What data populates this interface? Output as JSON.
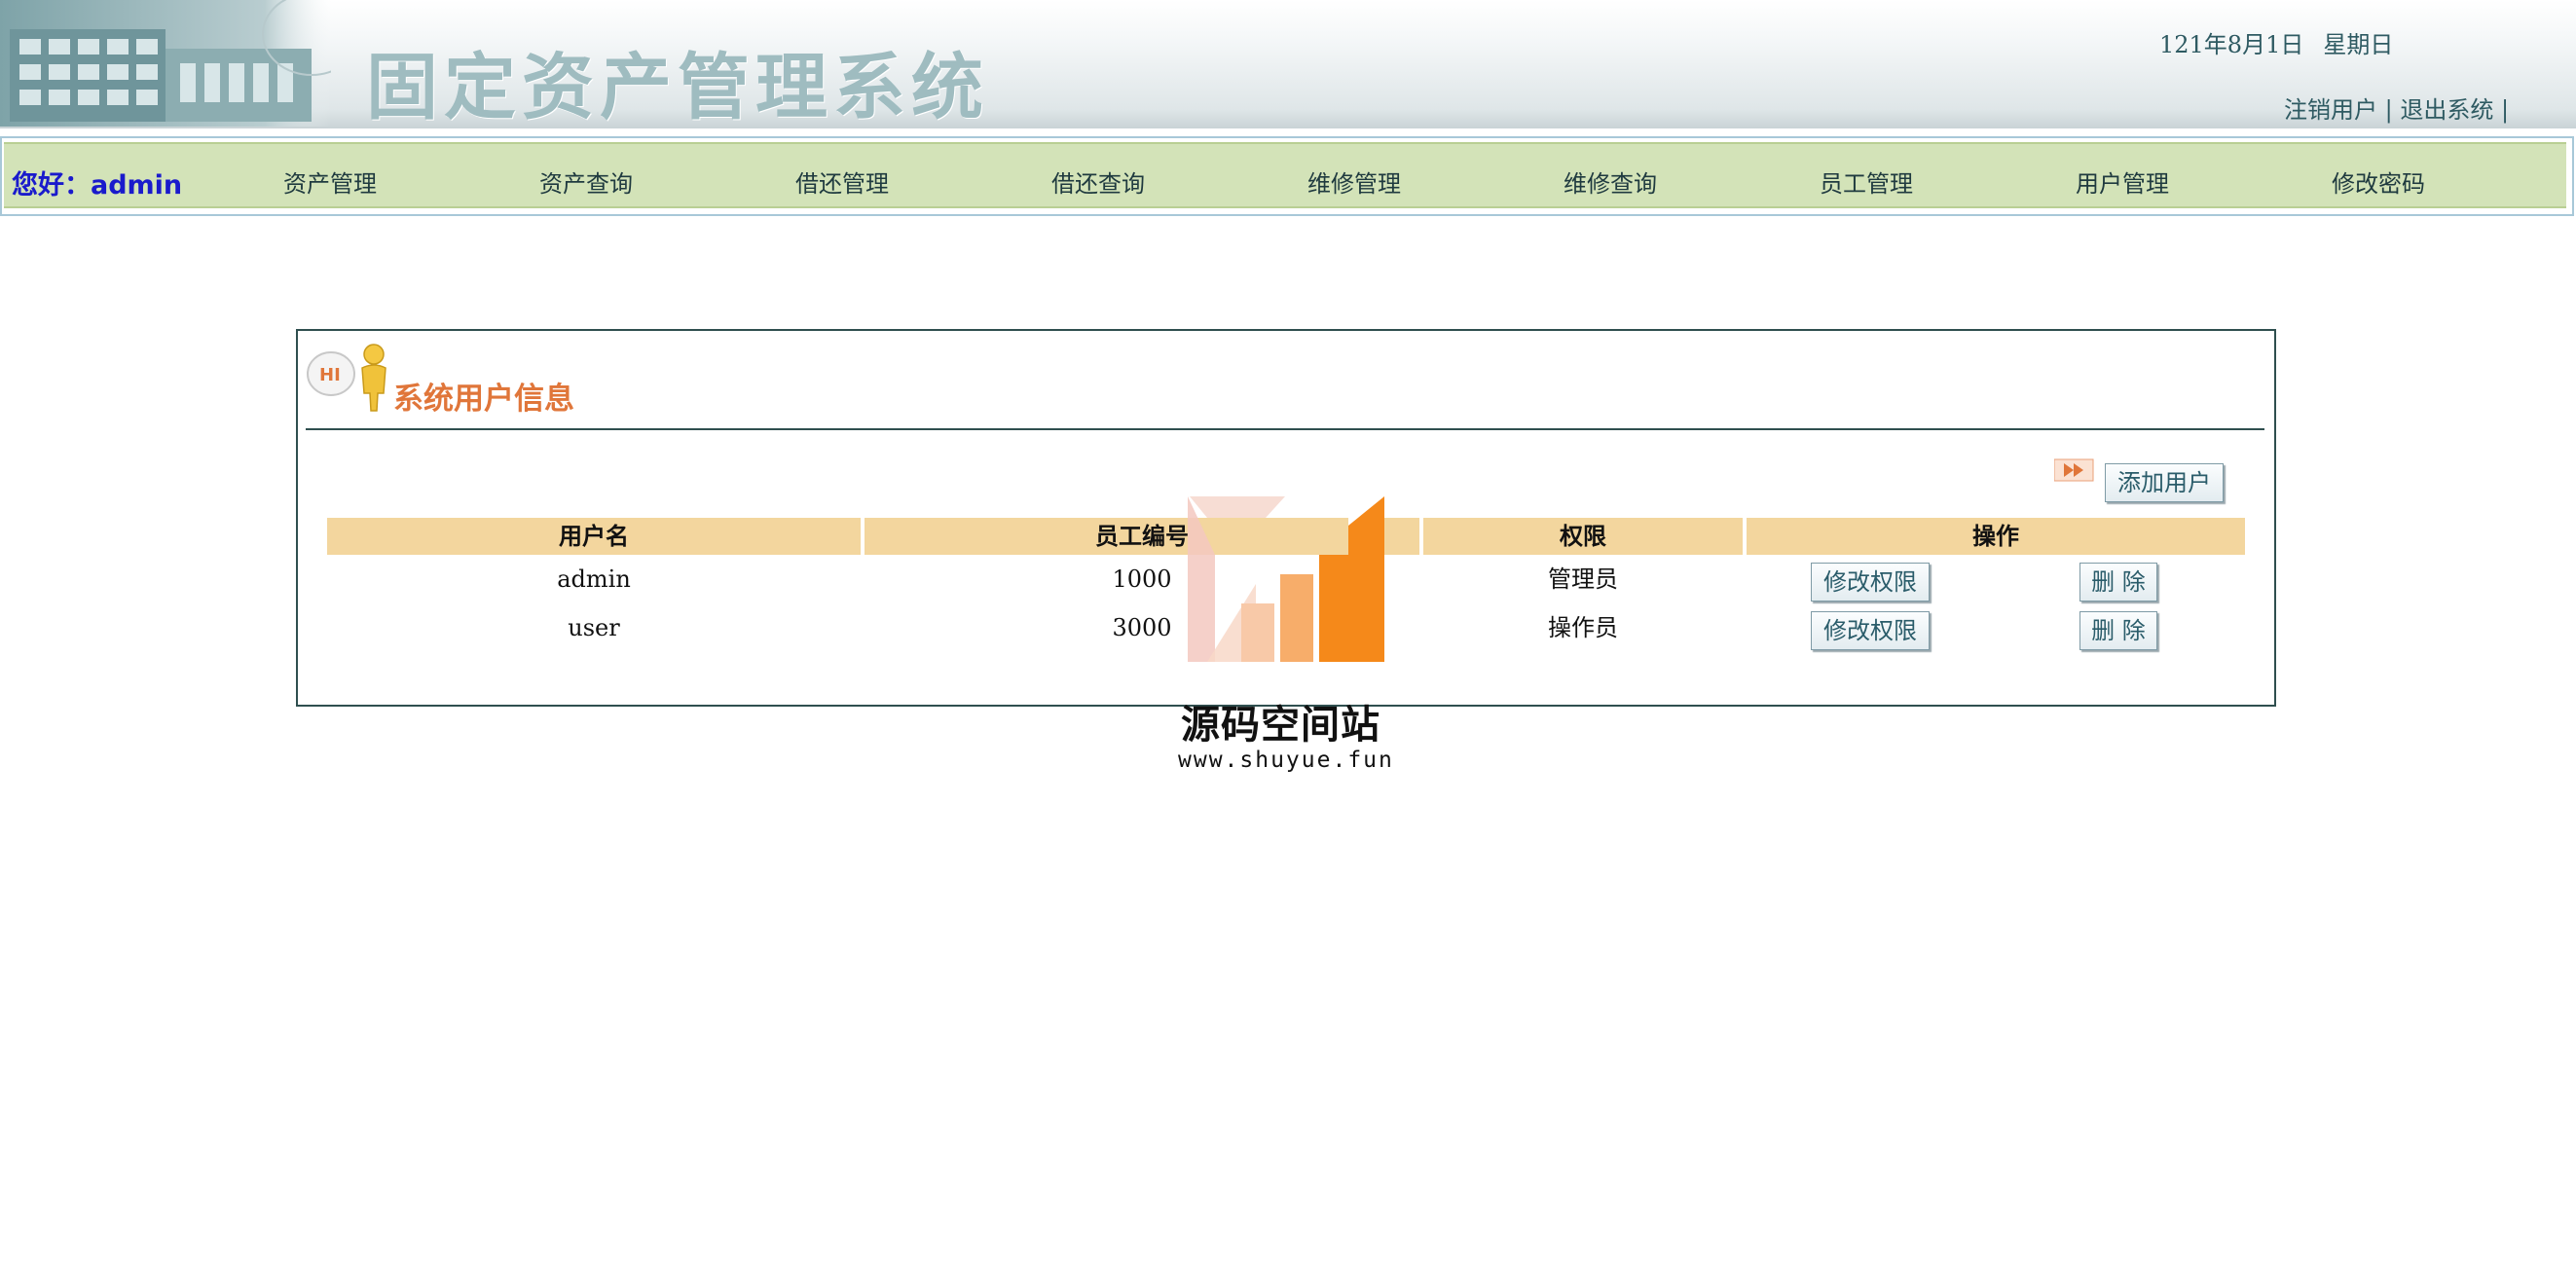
{
  "header": {
    "title": "固定资产管理系统",
    "date": "121年8月1日",
    "weekday": "星期日",
    "logout_user": "注销用户",
    "exit_system": "退出系统",
    "separator": "|"
  },
  "nav": {
    "greeting": "您好：admin",
    "items": [
      "资产管理",
      "资产查询",
      "借还管理",
      "借还查询",
      "维修管理",
      "维修查询",
      "员工管理",
      "用户管理",
      "修改密码"
    ]
  },
  "panel": {
    "title": "系统用户信息",
    "hi_badge": "HI",
    "add_user_button": "添加用户",
    "table": {
      "headers": [
        "用户名",
        "员工编号",
        "权限",
        "操作"
      ],
      "rows": [
        {
          "username": "admin",
          "employee_no": "1000",
          "role": "管理员",
          "edit_label": "修改权限",
          "delete_label": "删 除"
        },
        {
          "username": "user",
          "employee_no": "3000",
          "role": "操作员",
          "edit_label": "修改权限",
          "delete_label": "删 除"
        }
      ]
    }
  },
  "watermark": {
    "name": "源码空间站",
    "url": "www.shuyue.fun"
  },
  "colors": {
    "nav_bg": "#d3e3b8",
    "table_header_bg": "#f3d69e",
    "panel_title": "#e0763a",
    "greeting": "#1a1acc",
    "watermark_orange": "#f5891a"
  }
}
